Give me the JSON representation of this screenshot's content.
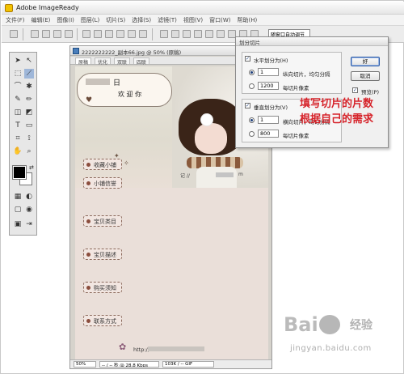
{
  "window": {
    "title": "Adobe ImageReady"
  },
  "menu": [
    "文件(F)",
    "编辑(E)",
    "图像(I)",
    "图层(L)",
    "切片(S)",
    "选择(S)",
    "滤镜(T)",
    "视图(V)",
    "窗口(W)",
    "帮助(H)"
  ],
  "toolbar": {
    "combo_value": "随窗口自动调节"
  },
  "document": {
    "title": "2222222222_副本66.jpg @ 50% (原稿)",
    "tabs": [
      "原稿",
      "优化",
      "双联",
      "四联"
    ],
    "banner_line1": "日",
    "banner_line2": "欢 迎 你",
    "banner_sig": "记 //",
    "banner_sig_tail": "m",
    "categories": [
      "收藏小铺",
      "小铺信誉",
      "宝贝类目",
      "宝贝描述",
      "购买须知",
      "联系方式"
    ],
    "footer_text": "http://",
    "status": {
      "zoom": "50%",
      "speed": "-- / -- 秒 @ 28.8 Kbps",
      "format": "103K / -- GIF"
    }
  },
  "dialog": {
    "title": "划分切片",
    "horizontal": {
      "label": "水平划分为(H)",
      "opt1_value": "1",
      "opt1_label": "纵向切片，均匀分隔",
      "opt2_value": "1200",
      "opt2_label": "每切片像素"
    },
    "vertical": {
      "label": "垂直划分为(V)",
      "opt1_value": "1",
      "opt1_label": "横向切片，均匀分隔",
      "opt2_value": "800",
      "opt2_label": "每切片像素"
    },
    "ok_label": "好",
    "cancel_label": "取消",
    "preview_label": "预览(P)"
  },
  "annotation": {
    "line1": "填写切片的片数",
    "line2": "根据自己的需求"
  },
  "watermark": {
    "brand": "Bai",
    "brand_cn": "经验",
    "url": "jingyan.baidu.com"
  },
  "colors": {
    "annotation": "#d6232a",
    "accent": "#1d3f7a"
  }
}
